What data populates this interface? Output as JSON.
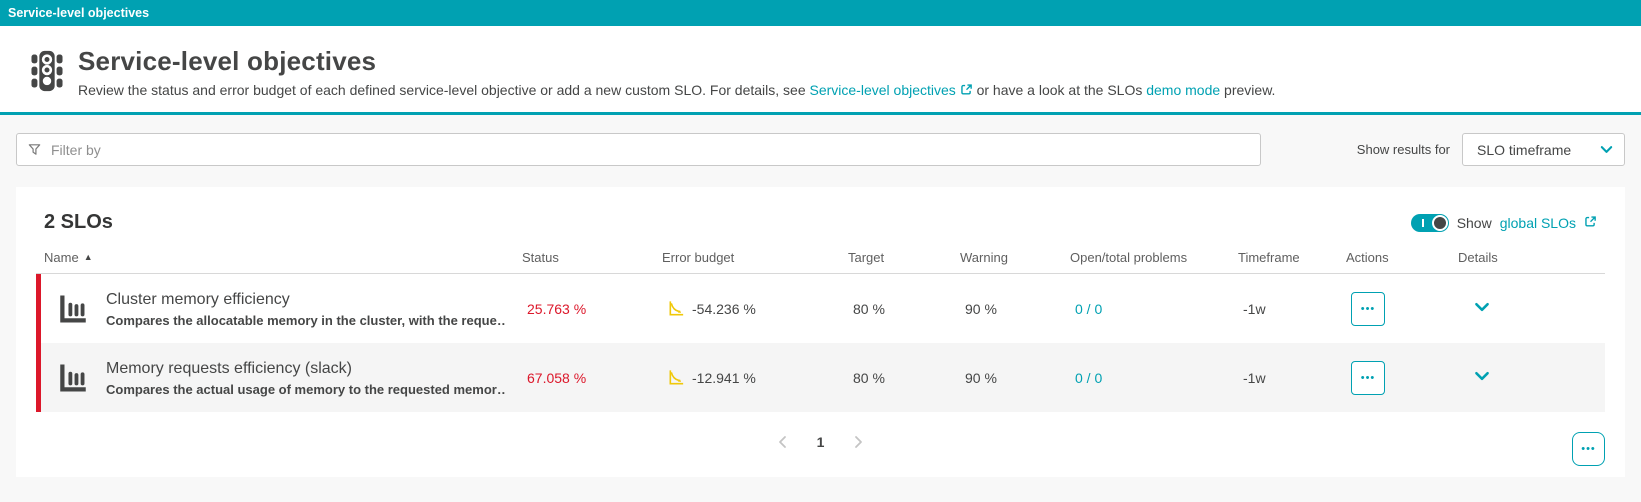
{
  "colors": {
    "accent_teal": "#00a1b2",
    "status_red": "#dc172a",
    "budget_yellow": "#f0c808",
    "text_dark": "#454646"
  },
  "topbar": {
    "title": "Service-level objectives"
  },
  "header": {
    "title": "Service-level objectives",
    "desc_before": "Review the status and error budget of each defined service-level objective or add a new custom SLO. For details, see ",
    "desc_link1": "Service-level objectives",
    "desc_middle": " or have a look at the SLOs ",
    "desc_link2": "demo mode",
    "desc_after": " preview."
  },
  "filter": {
    "placeholder": "Filter by"
  },
  "results_for": {
    "label": "Show results for",
    "value": "SLO timeframe"
  },
  "card": {
    "count": "2 SLOs",
    "show_prefix": "Show",
    "global_link": "global SLOs"
  },
  "table": {
    "sort_indicator": "▲",
    "columns": [
      "Name",
      "Status",
      "Error budget",
      "Target",
      "Warning",
      "Open/total problems",
      "Timeframe",
      "Actions",
      "Details"
    ],
    "rows": [
      {
        "name": "Cluster memory efficiency",
        "description": "Compares the allocatable memory in the cluster, with the reque…",
        "status": "25.763 %",
        "error_budget": "-54.236 %",
        "target": "80 %",
        "warning": "90 %",
        "problems": "0 / 0",
        "timeframe": "-1w"
      },
      {
        "name": "Memory requests efficiency (slack)",
        "description": "Compares the actual usage of memory to the requested memor…",
        "status": "67.058 %",
        "error_budget": "-12.941 %",
        "target": "80 %",
        "warning": "90 %",
        "problems": "0 / 0",
        "timeframe": "-1w"
      }
    ]
  },
  "pagination": {
    "current_page": "1"
  },
  "icons": {
    "more": "•••"
  }
}
